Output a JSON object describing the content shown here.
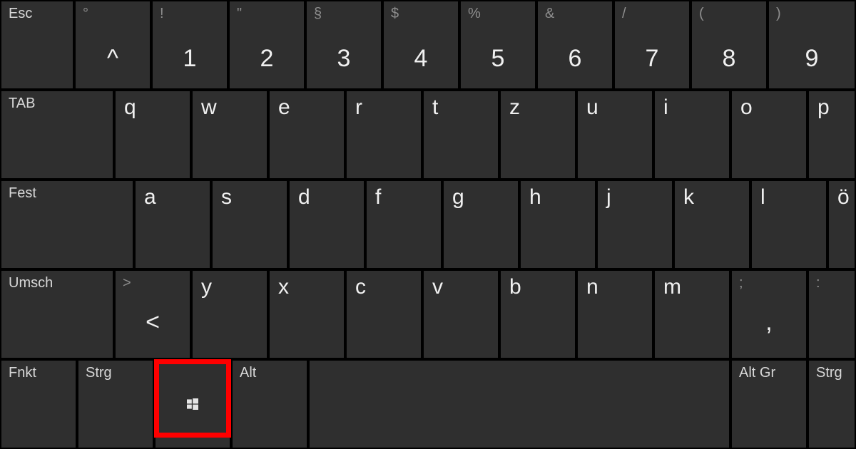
{
  "row1_func": {
    "esc": "Esc"
  },
  "row1": {
    "caret_sec": "°",
    "caret_main": "^",
    "n1_sec": "!",
    "n1_main": "1",
    "n2_sec": "\"",
    "n2_main": "2",
    "n3_sec": "§",
    "n3_main": "3",
    "n4_sec": "$",
    "n4_main": "4",
    "n5_sec": "%",
    "n5_main": "5",
    "n6_sec": "&",
    "n6_main": "6",
    "n7_sec": "/",
    "n7_main": "7",
    "n8_sec": "(",
    "n8_main": "8",
    "n9_sec": ")",
    "n9_main": "9"
  },
  "row2_func": {
    "tab": "TAB"
  },
  "row2": {
    "q": "q",
    "w": "w",
    "e": "e",
    "r": "r",
    "t": "t",
    "z": "z",
    "u": "u",
    "i": "i",
    "o": "o",
    "p": "p"
  },
  "row3_func": {
    "caps": "Fest"
  },
  "row3": {
    "a": "a",
    "s": "s",
    "d": "d",
    "f": "f",
    "g": "g",
    "h": "h",
    "j": "j",
    "k": "k",
    "l": "l",
    "oe": "ö"
  },
  "row4_func": {
    "shift": "Umsch"
  },
  "row4": {
    "lt_sec": ">",
    "lt_main": "<",
    "y": "y",
    "x": "x",
    "c": "c",
    "v": "v",
    "b": "b",
    "n": "n",
    "m": "m",
    "semi_sec": ";",
    "semi_main": ",",
    "colon_sec": ":",
    "colon_main": "."
  },
  "row5": {
    "fnkt": "Fnkt",
    "strgL": "Strg",
    "alt": "Alt",
    "altgr": "Alt Gr",
    "strgR": "Strg"
  },
  "highlight": {
    "target": "win-key"
  }
}
